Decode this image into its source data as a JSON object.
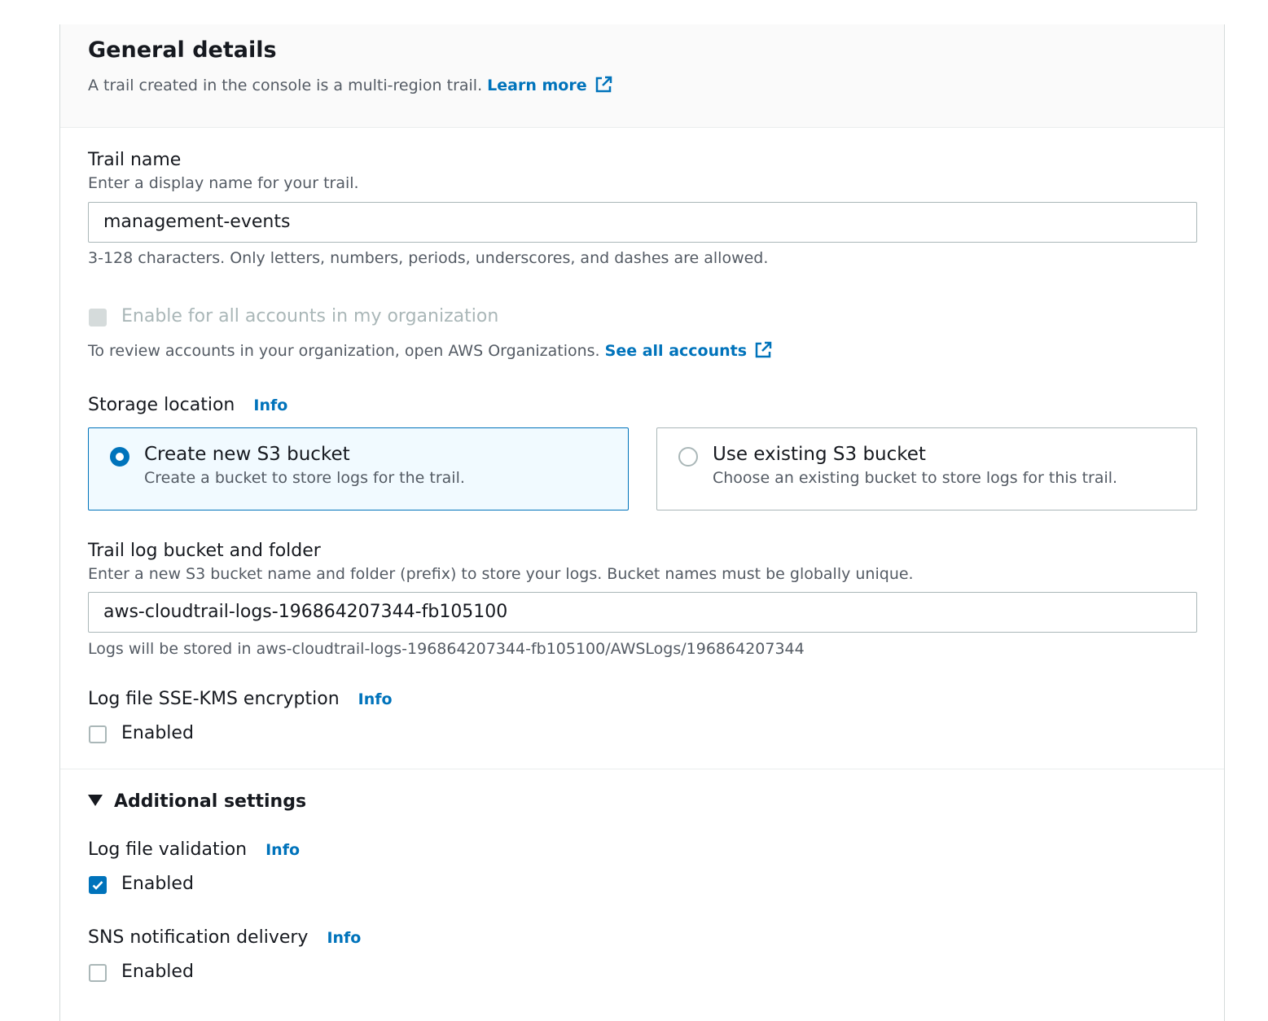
{
  "general": {
    "title": "General details",
    "description": "A trail created in the console is a multi-region trail.",
    "learn_more": "Learn more"
  },
  "trail_name": {
    "label": "Trail name",
    "description": "Enter a display name for your trail.",
    "value": "management-events",
    "constraint": "3-128 characters. Only letters, numbers, periods, underscores, and dashes are allowed."
  },
  "organization": {
    "checkbox_label": "Enable for all accounts in my organization",
    "checked": false,
    "disabled": true,
    "description": "To review accounts in your organization, open AWS Organizations.",
    "link": "See all accounts"
  },
  "storage": {
    "label": "Storage location",
    "info": "Info",
    "options": [
      {
        "title": "Create new S3 bucket",
        "description": "Create a bucket to store logs for the trail.",
        "selected": true
      },
      {
        "title": "Use existing S3 bucket",
        "description": "Choose an existing bucket to store logs for this trail.",
        "selected": false
      }
    ]
  },
  "bucket": {
    "label": "Trail log bucket and folder",
    "description": "Enter a new S3 bucket name and folder (prefix) to store your logs. Bucket names must be globally unique.",
    "value": "aws-cloudtrail-logs-196864207344-fb105100",
    "hint": "Logs will be stored in aws-cloudtrail-logs-196864207344-fb105100/AWSLogs/196864207344"
  },
  "kms": {
    "label": "Log file SSE-KMS encryption",
    "info": "Info",
    "checkbox_label": "Enabled",
    "checked": false
  },
  "additional": {
    "title": "Additional settings",
    "expanded": true
  },
  "validation": {
    "label": "Log file validation",
    "info": "Info",
    "checkbox_label": "Enabled",
    "checked": true
  },
  "sns": {
    "label": "SNS notification delivery",
    "info": "Info",
    "checkbox_label": "Enabled",
    "checked": false
  },
  "colors": {
    "link": "#0073bb",
    "selected_tile_bg": "#f1faff",
    "header_bg": "#fafafa",
    "border": "#aab7b8"
  }
}
